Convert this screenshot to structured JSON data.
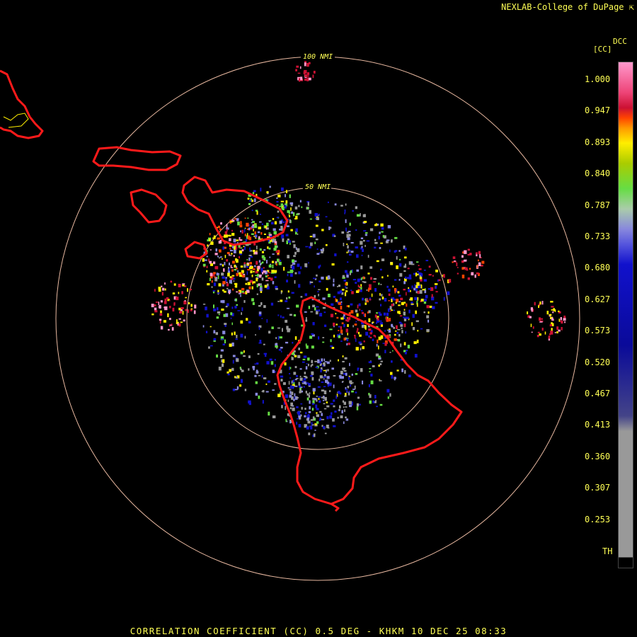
{
  "header": {
    "credit": "NEXLAB-College of DuPage"
  },
  "footer": {
    "caption": "CORRELATION COEFFICIENT (CC) 0.5 DEG - KHKM 10 DEC 25 08:33"
  },
  "range_rings": {
    "inner_label": "50 NMI",
    "outer_label": "100 NMI"
  },
  "legend": {
    "product": "DCC",
    "unit": "[CC]",
    "ticks": [
      "1.000",
      "0.947",
      "0.893",
      "0.840",
      "0.787",
      "0.733",
      "0.680",
      "0.627",
      "0.573",
      "0.520",
      "0.467",
      "0.413",
      "0.360",
      "0.307",
      "0.253"
    ],
    "threshold_label": "TH"
  },
  "colors": {
    "background": "#000000",
    "coastline": "#ff1a1a",
    "range_ring": "#e8b8a0",
    "text": "#ffff55",
    "scale_high": "#ff99cc",
    "scale_red": "#cc1133",
    "scale_yellow": "#ffee00",
    "scale_green": "#66dd44",
    "scale_lavender": "#8888dd",
    "scale_blue": "#1111cc",
    "scale_gray": "#999999"
  }
}
